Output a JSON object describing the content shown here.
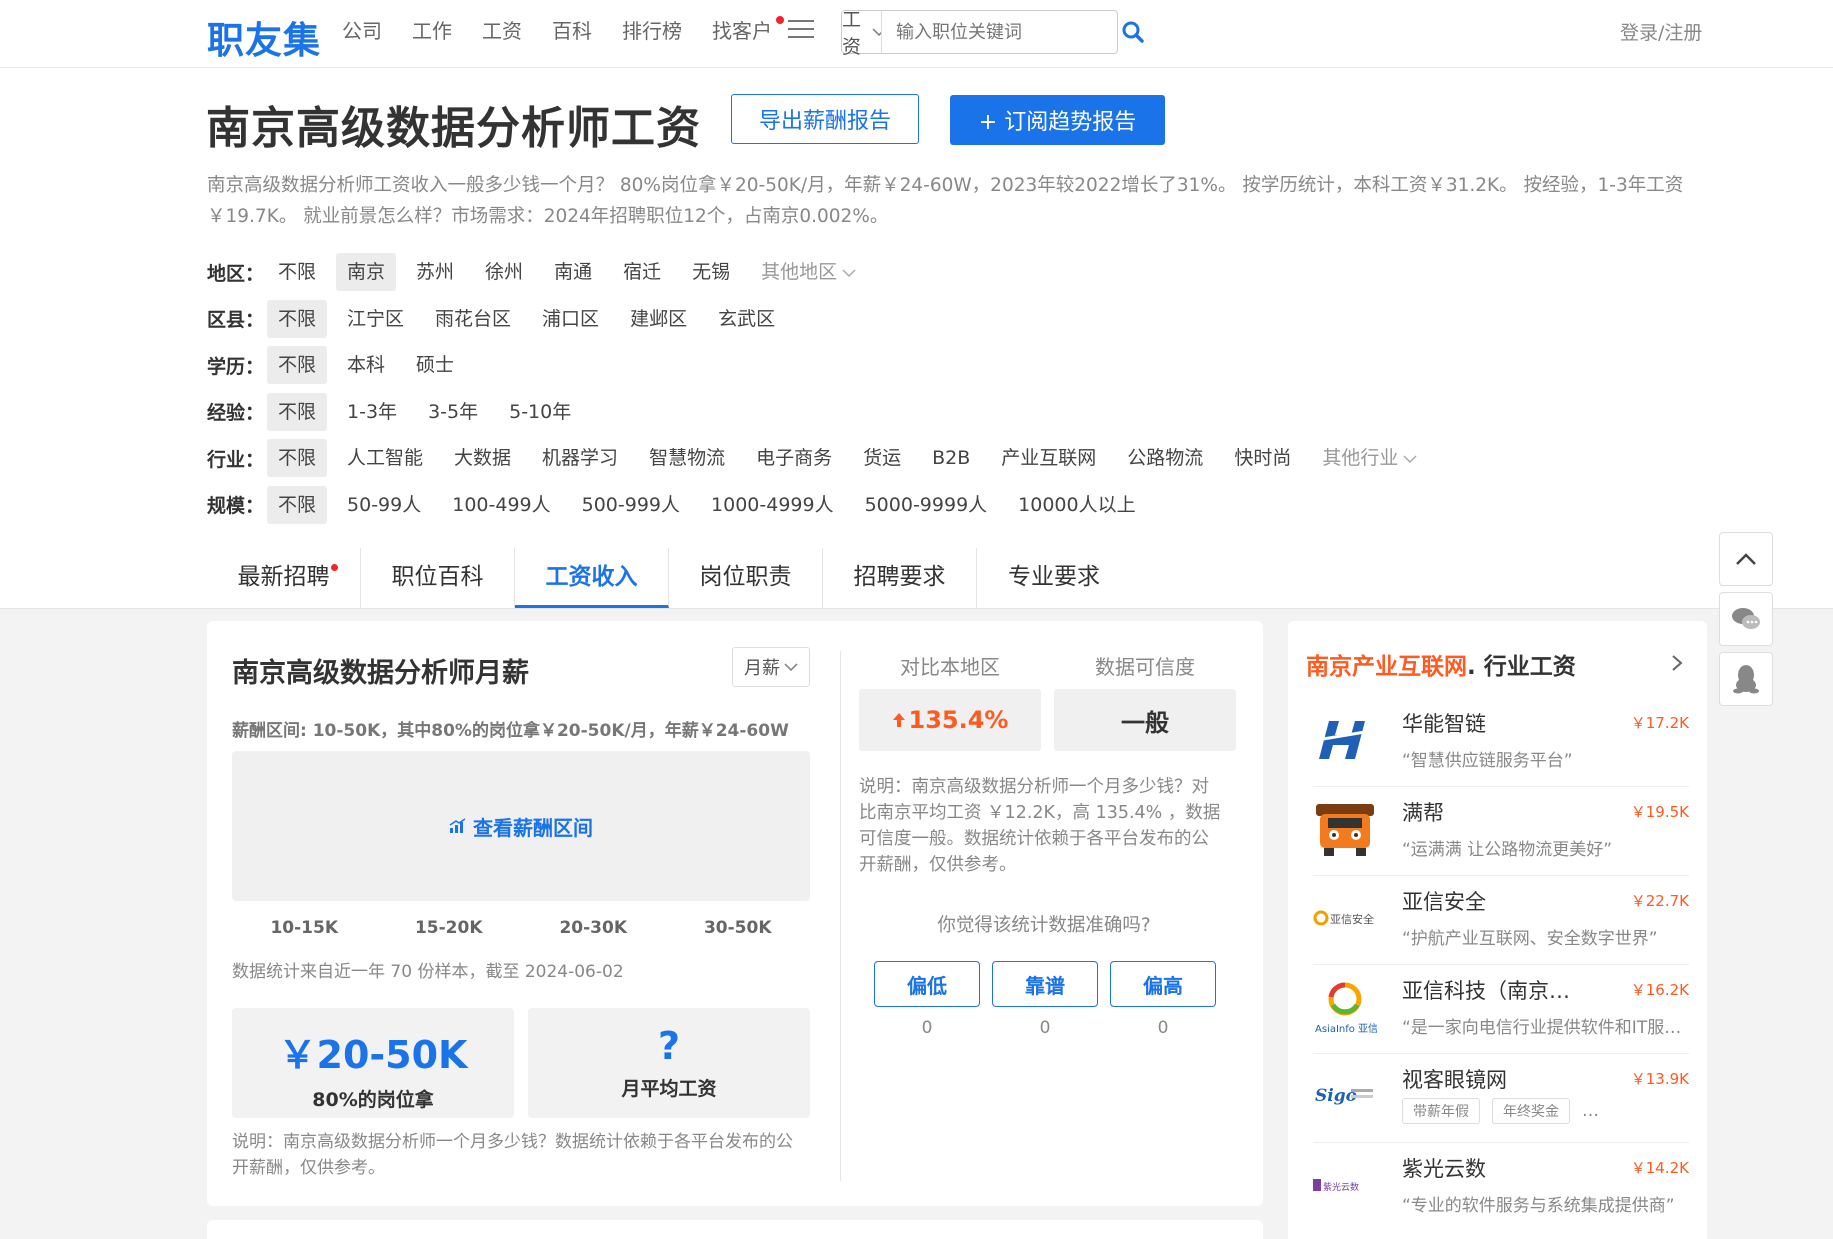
{
  "header": {
    "logo": "职友集",
    "nav": [
      "公司",
      "工作",
      "工资",
      "百科",
      "排行榜",
      "找客户"
    ],
    "search_type": "工资",
    "search_placeholder": "输入职位关键词",
    "login": "登录/注册"
  },
  "title": "南京高级数据分析师工资",
  "buttons": {
    "export": "导出薪酬报告",
    "subscribe": "+ 订阅趋势报告"
  },
  "description": "南京高级数据分析师工资收入一般多少钱一个月？ 80%岗位拿￥20-50K/月，年薪￥24-60W，2023年较2022增长了31%。 按学历统计，本科工资￥31.2K。 按经验，1-3年工资￥19.7K。 就业前景怎么样？市场需求：2024年招聘职位12个，占南京0.002%。",
  "filters": [
    {
      "label": "地区：",
      "options": [
        "不限",
        "南京",
        "苏州",
        "徐州",
        "南通",
        "宿迁",
        "无锡"
      ],
      "selected": 1,
      "more": "其他地区"
    },
    {
      "label": "区县：",
      "options": [
        "不限",
        "江宁区",
        "雨花台区",
        "浦口区",
        "建邺区",
        "玄武区"
      ],
      "selected": 0,
      "more": ""
    },
    {
      "label": "学历：",
      "options": [
        "不限",
        "本科",
        "硕士"
      ],
      "selected": 0,
      "more": ""
    },
    {
      "label": "经验：",
      "options": [
        "不限",
        "1-3年",
        "3-5年",
        "5-10年"
      ],
      "selected": 0,
      "more": ""
    },
    {
      "label": "行业：",
      "options": [
        "不限",
        "人工智能",
        "大数据",
        "机器学习",
        "智慧物流",
        "电子商务",
        "货运",
        "B2B",
        "产业互联网",
        "公路物流",
        "快时尚"
      ],
      "selected": 0,
      "more": "其他行业"
    },
    {
      "label": "规模：",
      "options": [
        "不限",
        "50-99人",
        "100-499人",
        "500-999人",
        "1000-4999人",
        "5000-9999人",
        "10000人以上"
      ],
      "selected": 0,
      "more": ""
    }
  ],
  "tabs": [
    "最新招聘",
    "职位百科",
    "工资收入",
    "岗位职责",
    "招聘要求",
    "专业要求"
  ],
  "active_tab": 2,
  "salary": {
    "title": "南京高级数据分析师月薪",
    "period": "月薪",
    "range_text": "薪酬区间: 10-50K，其中80%的岗位拿￥20-50K/月，年薪￥24-60W",
    "range_button": "查看薪酬区间",
    "range_labels": [
      "10-15K",
      "15-20K",
      "20-30K",
      "30-50K"
    ],
    "sample_note": "数据统计来自近一年 70 份样本，截至 2024-06-02",
    "stat1_value": "￥20-50K",
    "stat1_caption": "80%的岗位拿",
    "stat2_value": "?",
    "stat2_caption": "月平均工资",
    "bottom_note": "说明：南京高级数据分析师一个月多少钱？数据统计依赖于各平台发布的公开薪酬，仅供参考。"
  },
  "compare": {
    "head1": "对比本地区",
    "head2": "数据可信度",
    "value1": "135.4%",
    "value2": "一般",
    "note": "说明：南京高级数据分析师一个月多少钱？对比南京平均工资 ￥12.2K，高 135.4% ，数据可信度一般。数据统计依赖于各平台发布的公开薪酬，仅供参考。",
    "question": "你觉得该统计数据准确吗?",
    "votes": [
      {
        "label": "偏低",
        "count": "0"
      },
      {
        "label": "靠谱",
        "count": "0"
      },
      {
        "label": "偏高",
        "count": "0"
      }
    ]
  },
  "side": {
    "title_hl": "南京产业互联网",
    "title_rest": ". 行业工资",
    "companies": [
      {
        "name": "华能智链",
        "salary": "￥17.2K",
        "slogan": "“智慧供应链服务平台”"
      },
      {
        "name": "满帮",
        "salary": "￥19.5K",
        "slogan": "“运满满 让公路物流更美好”"
      },
      {
        "name": "亚信安全",
        "salary": "￥22.7K",
        "slogan": "“护航产业互联网、安全数字世界”",
        "logo_text": "亚信安全"
      },
      {
        "name": "亚信科技（南京…",
        "salary": "￥16.2K",
        "slogan": "“是一家向电信行业提供软件和IT服务的公司”",
        "logo_text": "AsiaInfo 亚信"
      },
      {
        "name": "视客眼镜网",
        "salary": "￥13.9K",
        "tags": [
          "带薪年假",
          "年终奖金",
          "…"
        ],
        "logo_text": "Sigo"
      },
      {
        "name": "紫光云数",
        "salary": "￥14.2K",
        "slogan": "“专业的软件服务与系统集成提供商”",
        "logo_text": "紫光云数"
      }
    ]
  },
  "colors": {
    "accent": "#1a73e8",
    "orange": "#ff5a1f",
    "red_dot": "#f5222d"
  }
}
